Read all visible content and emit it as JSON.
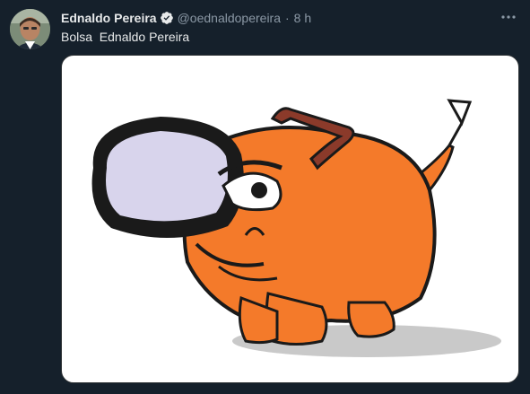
{
  "author": {
    "display_name": "Ednaldo Pereira",
    "verified": true,
    "handle": "@oednaldopereira",
    "separator": "·",
    "timestamp": "8 h"
  },
  "tweet": {
    "text": "Bolsa  Ednaldo Pereira"
  },
  "icons": {
    "verified": "verified-badge-icon",
    "more": "more-options-icon"
  },
  "colors": {
    "background": "#15202b",
    "primary_text": "#e7e9ea",
    "secondary_text": "#8b98a5",
    "figure_orange": "#f47a2a"
  }
}
